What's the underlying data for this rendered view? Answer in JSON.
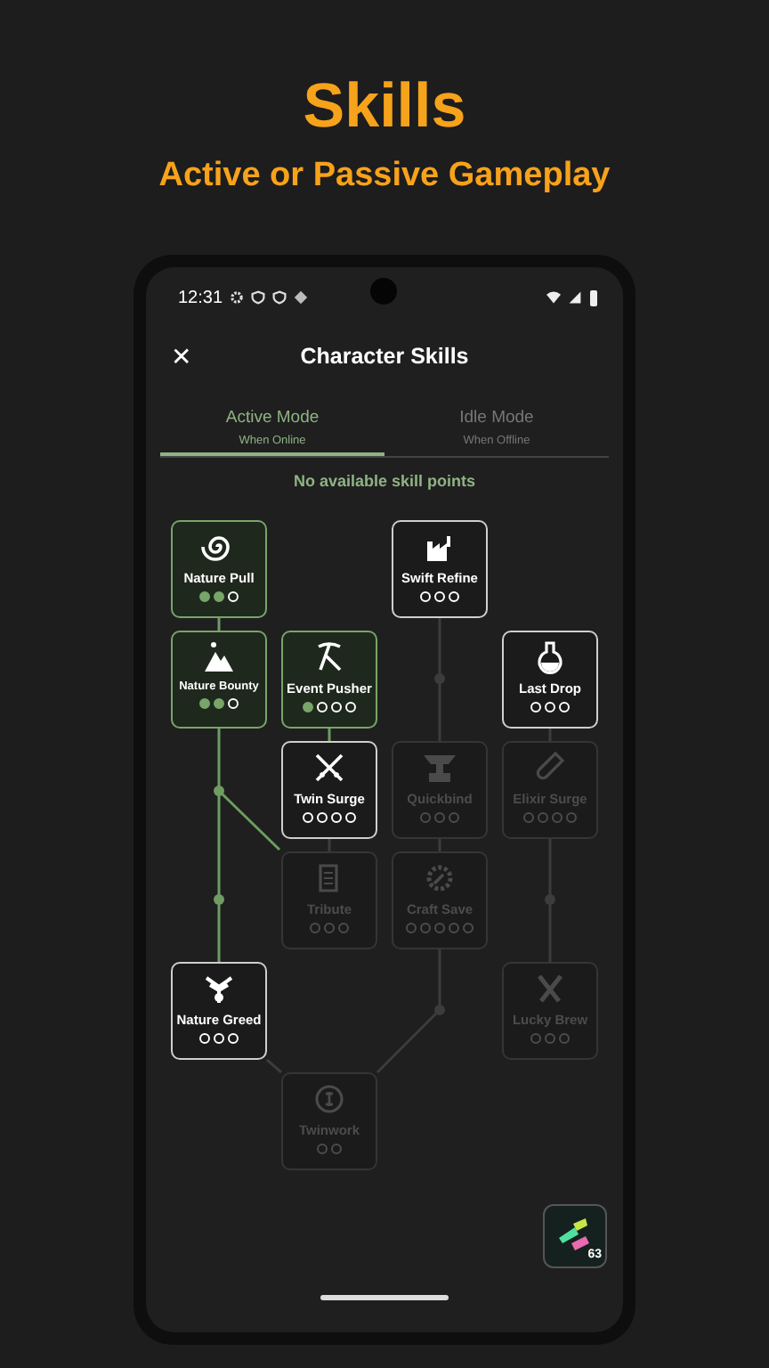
{
  "headline": "Skills",
  "subheadline": "Active or Passive Gameplay",
  "status_bar": {
    "time": "12:31"
  },
  "header": {
    "close": "✕",
    "title": "Character Skills"
  },
  "tabs": [
    {
      "label": "Active Mode",
      "sublabel": "When Online",
      "selected": true
    },
    {
      "label": "Idle Mode",
      "sublabel": "When Offline",
      "selected": false
    }
  ],
  "notice": "No available skill points",
  "nodes": [
    {
      "name": "Nature Pull",
      "kind": "active",
      "pips": [
        true,
        true,
        false
      ]
    },
    {
      "name": "Swift Refine",
      "kind": "available",
      "pips": [
        false,
        false,
        false
      ]
    },
    {
      "name": "Nature Bounty",
      "kind": "active",
      "pips": [
        true,
        true,
        false
      ]
    },
    {
      "name": "Event Pusher",
      "kind": "active",
      "pips": [
        true,
        false,
        false,
        false
      ]
    },
    {
      "name": "Last Drop",
      "kind": "available",
      "pips": [
        false,
        false,
        false
      ]
    },
    {
      "name": "Twin Surge",
      "kind": "available",
      "pips": [
        false,
        false,
        false,
        false
      ]
    },
    {
      "name": "Quickbind",
      "kind": "locked",
      "pips": [
        false,
        false,
        false
      ]
    },
    {
      "name": "Elixir Surge",
      "kind": "locked",
      "pips": [
        false,
        false,
        false,
        false
      ]
    },
    {
      "name": "Tribute",
      "kind": "locked",
      "pips": [
        false,
        false,
        false
      ]
    },
    {
      "name": "Craft Save",
      "kind": "locked",
      "pips": [
        false,
        false,
        false,
        false,
        false
      ]
    },
    {
      "name": "Nature Greed",
      "kind": "available",
      "pips": [
        false,
        false,
        false
      ]
    },
    {
      "name": "Lucky Brew",
      "kind": "locked",
      "pips": [
        false,
        false,
        false
      ]
    },
    {
      "name": "Twinwork",
      "kind": "locked",
      "pips": [
        false,
        false
      ]
    }
  ],
  "inventory": {
    "count": "63"
  }
}
